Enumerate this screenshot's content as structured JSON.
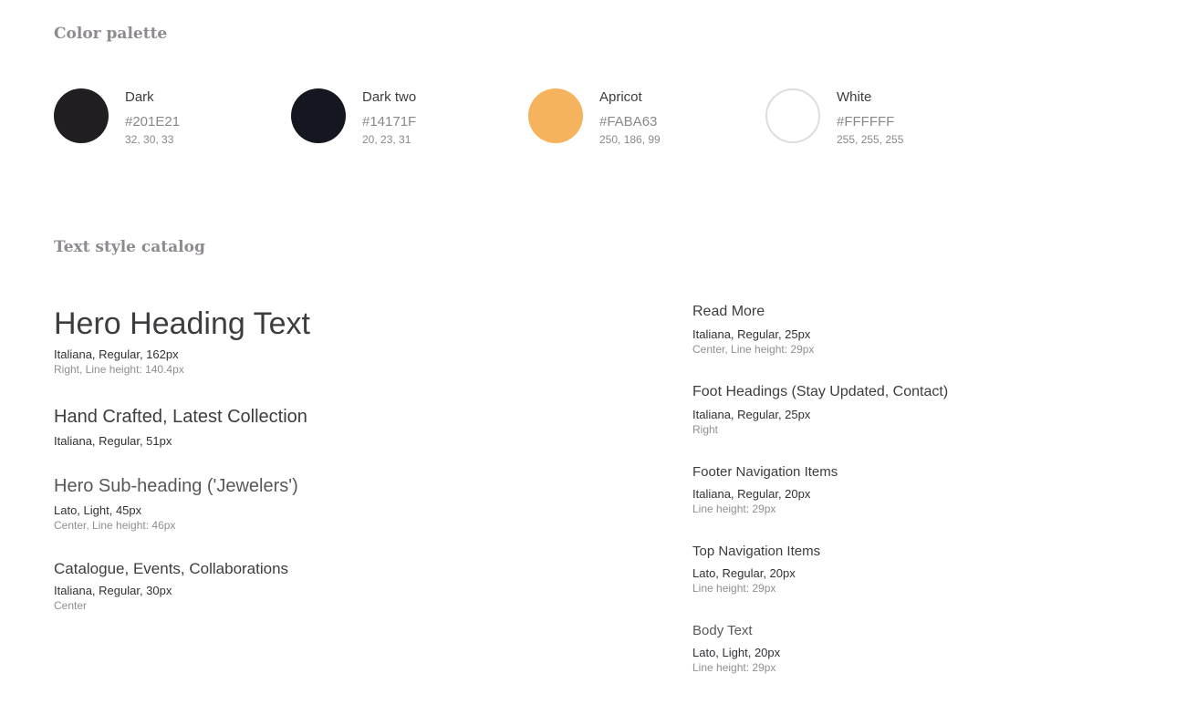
{
  "palette": {
    "title": "Color palette",
    "colors": [
      {
        "name": "Dark",
        "hex": "#201E21",
        "rgb": "32, 30, 33",
        "swatch": "#201E21",
        "border": "#201E21"
      },
      {
        "name": "Dark two",
        "hex": "#14171F",
        "rgb": "20, 23, 31",
        "swatch": "#14171F",
        "border": "#14171F"
      },
      {
        "name": "Apricot",
        "hex": "#FABA63",
        "rgb": "250, 186, 99",
        "swatch": "#F6B35E",
        "border": "#F6B35E"
      },
      {
        "name": "White",
        "hex": "#FFFFFF",
        "rgb": "255, 255, 255",
        "swatch": "#FFFFFF",
        "border": "#DDDDDD"
      }
    ]
  },
  "catalog": {
    "title": "Text style catalog",
    "left": [
      {
        "sample": "Hero Heading Text",
        "spec": "Italiana, Regular, 162px",
        "meta": "Right, Line height: 140.4px"
      },
      {
        "sample": "Hand Crafted, Latest Collection",
        "spec": "Italiana, Regular, 51px",
        "meta": ""
      },
      {
        "sample": "Hero Sub-heading ('Jewelers')",
        "spec": "Lato, Light, 45px",
        "meta": "Center, Line height: 46px"
      },
      {
        "sample": "Catalogue, Events, Collaborations",
        "spec": "Italiana, Regular, 30px",
        "meta": "Center"
      }
    ],
    "right": [
      {
        "sample": "Read More",
        "spec": "Italiana, Regular, 25px",
        "meta": "Center, Line height: 29px"
      },
      {
        "sample": "Foot Headings (Stay Updated, Contact)",
        "spec": "Italiana, Regular, 25px",
        "meta": "Right"
      },
      {
        "sample": "Footer Navigation Items",
        "spec": "Italiana, Regular, 20px",
        "meta": "Line height: 29px"
      },
      {
        "sample": "Top Navigation Items",
        "spec": "Lato, Regular, 20px",
        "meta": "Line height: 29px"
      },
      {
        "sample": "Body Text",
        "spec": "Lato, Light, 20px",
        "meta": "Line height: 29px"
      }
    ]
  }
}
